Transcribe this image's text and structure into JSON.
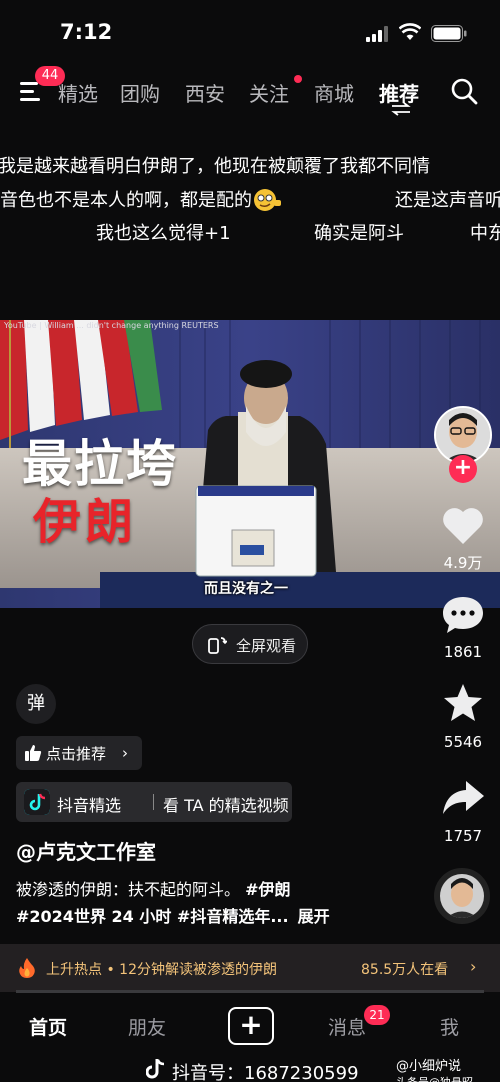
{
  "status_bar": {
    "time": "7:12"
  },
  "top_nav": {
    "menu_badge": "44",
    "tabs": [
      "精选",
      "团购",
      "西安",
      "关注",
      "商城",
      "推荐"
    ],
    "active_tab": "推荐"
  },
  "danmaku": {
    "line1": "我是越来越看明白伊朗了，他现在被颠覆了我都不同情",
    "line2a": "音色也不是本人的啊，都是配的",
    "line2b": "还是这声音听",
    "line3a": "我也这么觉得+1",
    "line3b": "确实是阿斗",
    "line3c": "中东"
  },
  "video": {
    "top_caption": "YouTube | William ... didn't change anything  REUTERS",
    "headline1": "最拉垮",
    "headline2": "伊朗",
    "subtitle": "而且没有之一"
  },
  "fullscreen_button": "全屏观看",
  "right_rail": {
    "likes": "4.9万",
    "comments": "1861",
    "favorites": "5546",
    "shares": "1757"
  },
  "danmaku_button": "弹",
  "recommend_button": "点击推荐",
  "jingxuan": {
    "brand": "抖音精选",
    "cta": "看 TA 的精选视频"
  },
  "author": "@卢克文工作室",
  "description": {
    "line1_text": "被渗透的伊朗：扶不起的阿斗。",
    "line1_tag": "#伊朗",
    "line2_tags": "#2024世界 24 小时  #抖音精选年...",
    "expand": "展开"
  },
  "hot_bar": {
    "text": "上升热点 • 12分钟解读被渗透的伊朗",
    "count": "85.5万人在看",
    "progress": 0.0
  },
  "bottom_nav": {
    "home": "首页",
    "friends": "朋友",
    "messages": "消息",
    "messages_badge": "21",
    "me": "我"
  },
  "watermark": {
    "id_label": "抖音号：1687230599",
    "right_top": "@小细炉说",
    "right_bottom": "头条号@独悬昭"
  },
  "colors": {
    "accent": "#fe2c55",
    "hot": "#f3c37a",
    "background": "#0b0b0c"
  }
}
